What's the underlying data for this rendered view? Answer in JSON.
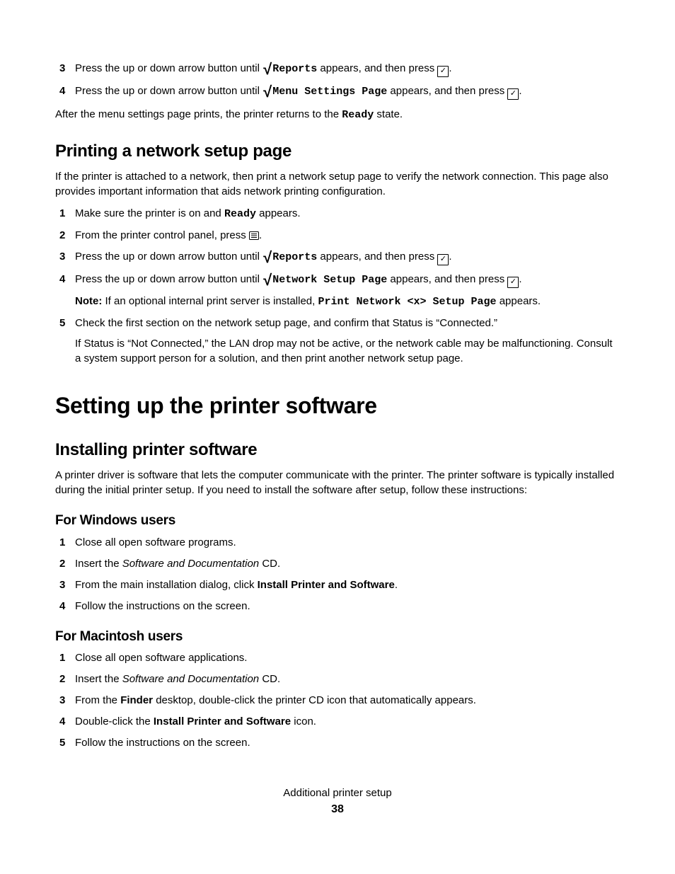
{
  "top_steps": {
    "items": [
      {
        "num": "3",
        "pre": "Press the up or down arrow button until ",
        "mono": "Reports",
        "post": " appears, and then press ",
        "tail": "."
      },
      {
        "num": "4",
        "pre": "Press the up or down arrow button until ",
        "mono": "Menu Settings Page",
        "post": " appears, and then press ",
        "tail": "."
      }
    ],
    "after_pre": "After the menu settings page prints, the printer returns to the ",
    "after_mono": "Ready",
    "after_post": " state."
  },
  "h2_network": "Printing a network setup page",
  "network_intro": "If the printer is attached to a network, then print a network setup page to verify the network connection. This page also provides important information that aids network printing configuration.",
  "network_steps": {
    "s1": {
      "num": "1",
      "pre": "Make sure the printer is on and ",
      "mono": "Ready",
      "post": " appears."
    },
    "s2": {
      "num": "2",
      "pre": "From the printer control panel, press ",
      "post": "."
    },
    "s3": {
      "num": "3",
      "pre": "Press the up or down arrow button until ",
      "mono": "Reports",
      "post": " appears, and then press ",
      "tail": "."
    },
    "s4": {
      "num": "4",
      "pre": "Press the up or down arrow button until ",
      "mono": "Network Setup Page",
      "post": " appears, and then press ",
      "tail": ".",
      "note_label": "Note:",
      "note_pre": " If an optional internal print server is installed, ",
      "note_mono": "Print Network <x> Setup Page",
      "note_post": " appears."
    },
    "s5": {
      "num": "5",
      "text": "Check the first section on the network setup page, and confirm that Status is “Connected.”",
      "sub": "If Status is “Not Connected,” the LAN drop may not be active, or the network cable may be malfunctioning. Consult a system support person for a solution, and then print another network setup page."
    }
  },
  "h1_software": "Setting up the printer software",
  "h2_install": "Installing printer software",
  "install_intro": "A printer driver is software that lets the computer communicate with the printer. The printer software is typically installed during the initial printer setup. If you need to install the software after setup, follow these instructions:",
  "h3_windows": "For Windows users",
  "windows_steps": {
    "s1": {
      "num": "1",
      "text": "Close all open software programs."
    },
    "s2": {
      "num": "2",
      "pre": "Insert the ",
      "italic": "Software and Documentation",
      "post": " CD."
    },
    "s3": {
      "num": "3",
      "pre": "From the main installation dialog, click ",
      "bold": "Install Printer and Software",
      "post": "."
    },
    "s4": {
      "num": "4",
      "text": "Follow the instructions on the screen."
    }
  },
  "h3_mac": "For Macintosh users",
  "mac_steps": {
    "s1": {
      "num": "1",
      "text": "Close all open software applications."
    },
    "s2": {
      "num": "2",
      "pre": "Insert the ",
      "italic": "Software and Documentation",
      "post": " CD."
    },
    "s3": {
      "num": "3",
      "pre": "From the ",
      "bold": "Finder",
      "post": " desktop, double-click the printer CD icon that automatically appears."
    },
    "s4": {
      "num": "4",
      "pre": "Double-click the ",
      "bold": "Install Printer and Software",
      "post": " icon."
    },
    "s5": {
      "num": "5",
      "text": "Follow the instructions on the screen."
    }
  },
  "footer": {
    "title": "Additional printer setup",
    "page": "38"
  }
}
